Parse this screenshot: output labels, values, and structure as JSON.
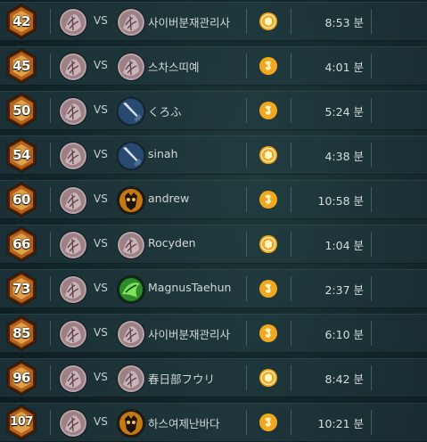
{
  "matches": [
    {
      "level": "42",
      "vs": "VS",
      "opponent": "사이버분재관리사",
      "opponent_avatar": "stone-hero",
      "result_icon": "coin-icon",
      "time": "8:53 분"
    },
    {
      "level": "45",
      "vs": "VS",
      "opponent": "스차스띠예",
      "opponent_avatar": "stone-hero",
      "result_icon": "swirl-icon",
      "time": "4:01 분"
    },
    {
      "level": "50",
      "vs": "VS",
      "opponent": "くろふ",
      "opponent_avatar": "blade-hero",
      "result_icon": "swirl-icon",
      "time": "5:24 분"
    },
    {
      "level": "54",
      "vs": "VS",
      "opponent": "sinah",
      "opponent_avatar": "blade-hero",
      "result_icon": "coin-icon",
      "time": "4:38 분"
    },
    {
      "level": "60",
      "vs": "VS",
      "opponent": "andrew",
      "opponent_avatar": "fire-hero",
      "result_icon": "swirl-icon",
      "time": "10:58 분"
    },
    {
      "level": "66",
      "vs": "VS",
      "opponent": "Rocyden",
      "opponent_avatar": "stone-hero",
      "result_icon": "coin-icon",
      "time": "1:04 분"
    },
    {
      "level": "73",
      "vs": "VS",
      "opponent": "MagnusTaehun",
      "opponent_avatar": "green-hero",
      "result_icon": "swirl-icon",
      "time": "2:37 분"
    },
    {
      "level": "85",
      "vs": "VS",
      "opponent": "사이버분재관리사",
      "opponent_avatar": "stone-hero",
      "result_icon": "swirl-icon",
      "time": "6:10 분"
    },
    {
      "level": "96",
      "vs": "VS",
      "opponent": "春日部フウリ",
      "opponent_avatar": "stone-hero",
      "result_icon": "coin-icon",
      "time": "8:42 분"
    },
    {
      "level": "107",
      "vs": "VS",
      "opponent": "하스여제난바다",
      "opponent_avatar": "fire-hero",
      "result_icon": "swirl-icon",
      "time": "10:21 분"
    }
  ],
  "colors": {
    "badge_outer": "#7a3d12",
    "badge_inner": "#c26a1f",
    "medal": "#f2a81e"
  }
}
